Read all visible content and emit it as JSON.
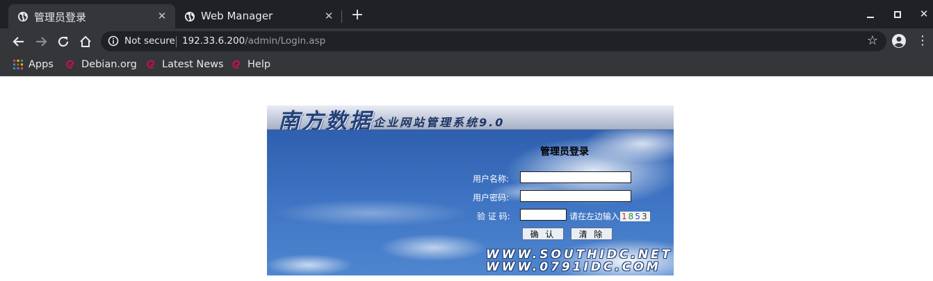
{
  "browser": {
    "tabs": [
      {
        "title": "管理员登录",
        "active": true
      },
      {
        "title": "Web Manager",
        "active": false
      }
    ],
    "new_tab_symbol": "+",
    "security_label": "Not secure",
    "url_host": "192.33.6.200",
    "url_path": "/admin/Login.asp",
    "bookmarks": [
      "Apps",
      "Debian.org",
      "Latest News",
      "Help"
    ],
    "theme_colors": {
      "frame": "#202124",
      "toolbar": "#35363a",
      "text": "#e8eaed",
      "debian_red": "#d70a53"
    }
  },
  "login": {
    "brand": "南方数据",
    "product": "企业网站管理系统9.0",
    "form_title": "管理员登录",
    "username_label": "用户名称:",
    "password_label": "用户密码:",
    "captcha_label": "验 证 码:",
    "username_value": "",
    "password_value": "",
    "captcha_value": "",
    "captcha_hint": "请在左边输入",
    "captcha_code": [
      "1",
      "8",
      "5",
      "3"
    ],
    "confirm_button": "确 认",
    "clear_button": "清 除",
    "sites": [
      "WWW.SOUTHIDC.NET",
      "WWW.0791IDC.COM"
    ]
  }
}
